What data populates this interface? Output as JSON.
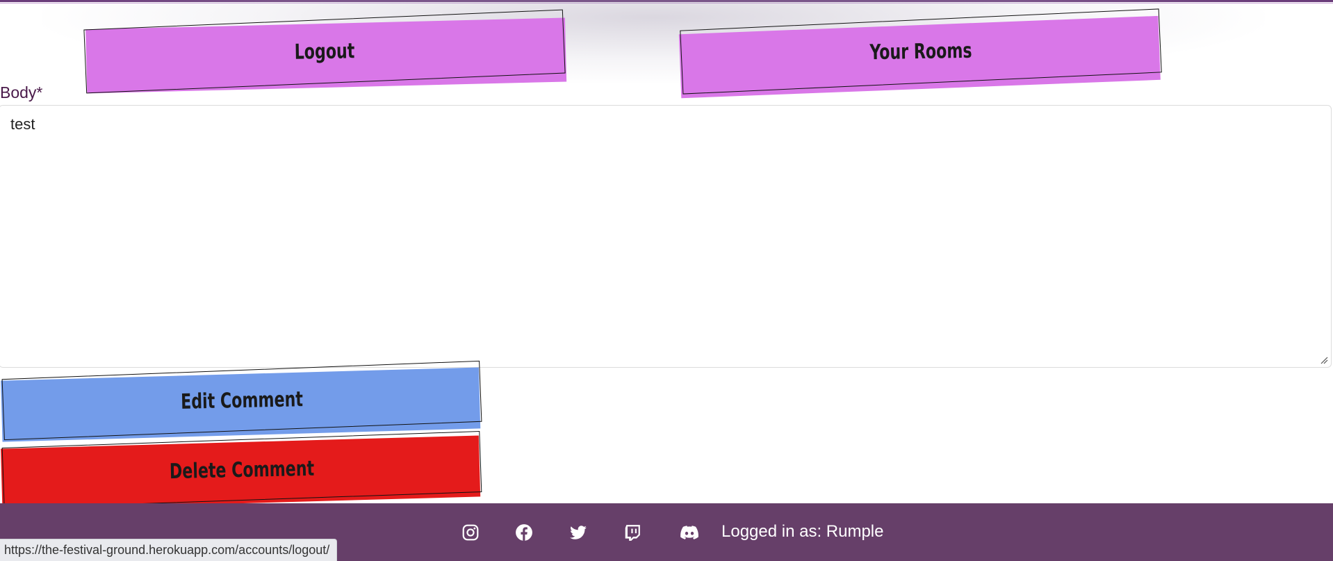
{
  "nav": {
    "logout_label": "Logout",
    "rooms_label": "Your Rooms"
  },
  "form": {
    "body_label": "Body*",
    "body_value": "test",
    "edit_label": "Edit Comment",
    "delete_label": "Delete Comment"
  },
  "footer": {
    "icons": [
      "instagram-icon",
      "facebook-icon",
      "twitter-icon",
      "twitch-icon",
      "discord-icon"
    ],
    "logged_in_text": "Logged in as: Rumple"
  },
  "status_bar": {
    "url": "https://the-festival-ground.herokuapp.com/accounts/logout/"
  },
  "colors": {
    "nav_button": "#d977e8",
    "edit_button": "#739cea",
    "delete_button": "#e41b1b",
    "footer": "#663f69",
    "top_border": "#6a3c7a"
  }
}
